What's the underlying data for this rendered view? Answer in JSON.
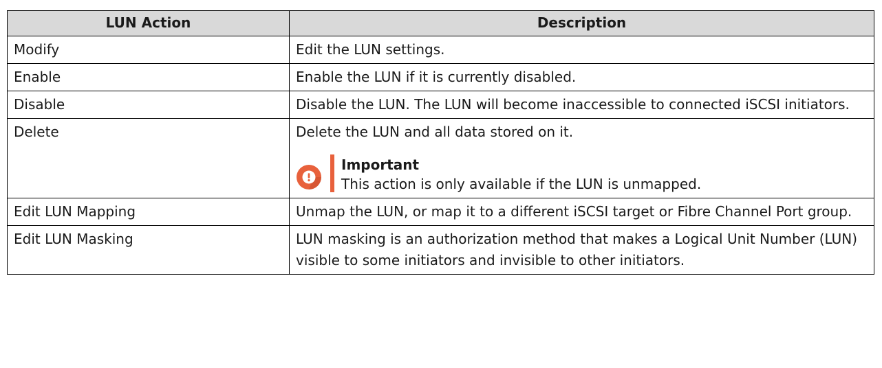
{
  "table": {
    "headers": [
      "LUN Action",
      "Description"
    ],
    "rows": [
      {
        "action": "Modify",
        "description": "Edit the LUN settings."
      },
      {
        "action": "Enable",
        "description": "Enable the LUN if it is currently disabled."
      },
      {
        "action": "Disable",
        "description": "Disable the LUN. The LUN will become inaccessible to connected iSCSI initiators."
      },
      {
        "action": "Delete",
        "description": "Delete the LUN and all data stored on it.",
        "note": {
          "icon": "exclamation-circle-icon",
          "color": "#e8613c",
          "title": "Important",
          "text": "This action is only available if the LUN is unmapped."
        }
      },
      {
        "action": "Edit LUN Mapping",
        "description": "Unmap the LUN, or map it to a different iSCSI target or Fibre Channel Port group."
      },
      {
        "action": "Edit LUN Masking",
        "description": "LUN masking is an authorization method that makes a Logical Unit Number (LUN) visible to some initiators and invisible to other initiators."
      }
    ]
  }
}
